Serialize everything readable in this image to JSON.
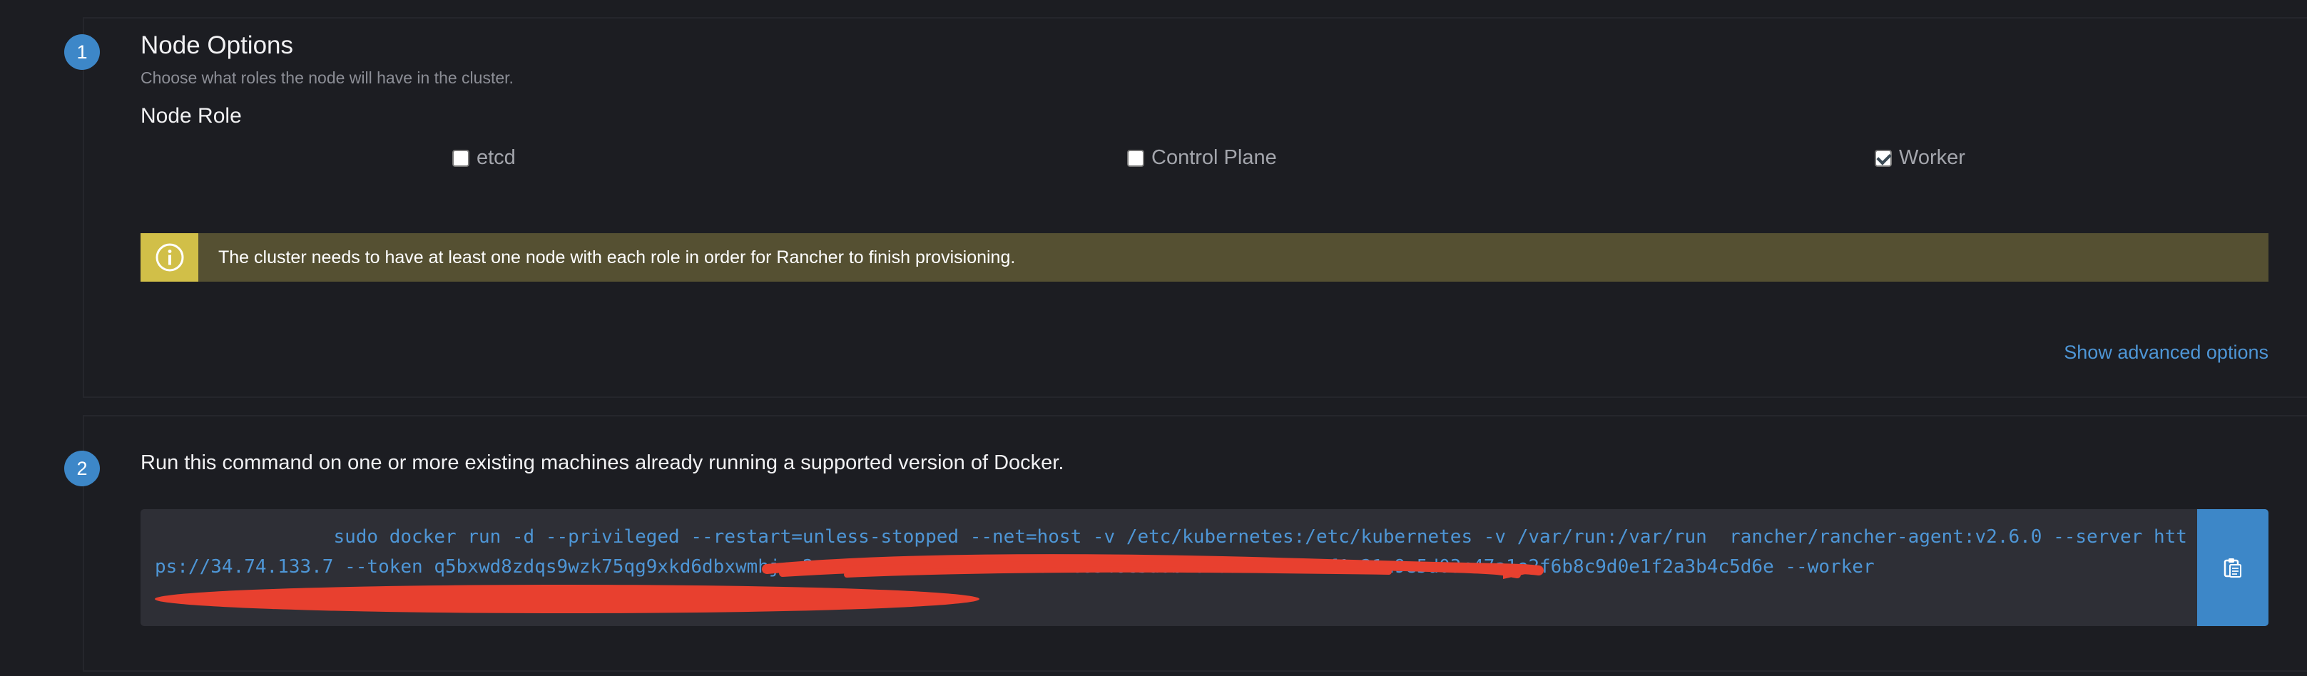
{
  "step1": {
    "number": "1",
    "title": "Node Options",
    "subtitle": "Choose what roles the node will have in the cluster.",
    "node_role_label": "Node Role",
    "roles": [
      {
        "label": "etcd",
        "checked": false
      },
      {
        "label": "Control Plane",
        "checked": false
      },
      {
        "label": "Worker",
        "checked": true
      }
    ],
    "banner": {
      "icon": "info-icon",
      "text": "The cluster needs to have at least one node with each role in order for Rancher to finish provisioning.",
      "color": "#555032",
      "icon_bg": "#d1bf48"
    },
    "advanced_link": "Show advanced options"
  },
  "step2": {
    "number": "2",
    "heading": "Run this command on one or more existing machines already running a supported version of Docker.",
    "command": "                sudo docker run -d --privileged --restart=unless-stopped --net=host -v /etc/kubernetes:/etc/kubernetes -v /var/run:/var/run  rancher/rancher-agent:v2.6.0 --server https://34.74.133.7 --token q5bxwd8zdqs9wzk75qg9xkd6dbxwmhjcr2wrdwb --ca-checksum 644c6946c5a0bfe2b0d8a8b3e7f1c21a9e5d03c47a1e2f6b8c9d0e1f2a3b4c5d6e --worker",
    "copy_icon": "clipboard-icon"
  },
  "colors": {
    "accent": "#3d87c8",
    "link": "#4e96d6",
    "redaction": "#e8402f"
  }
}
